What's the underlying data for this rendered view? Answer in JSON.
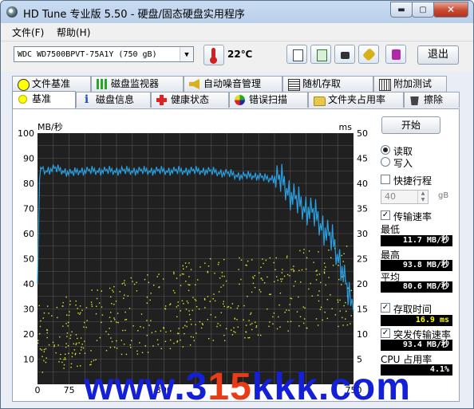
{
  "window": {
    "title": "HD Tune 专业版 5.50 - 硬盘/固态硬盘实用程序",
    "min": "▬",
    "max": "▢",
    "close": "✕"
  },
  "menu": {
    "file": "文件(F)",
    "help": "帮助(H)"
  },
  "toolbar": {
    "drive": "WDC    WD7500BPVT-75A1Y  (750 gB)",
    "temperature": "22℃",
    "exit": "退出"
  },
  "tabs_top": [
    {
      "label": "文件基准",
      "icon": "file-benchmark-icon"
    },
    {
      "label": "磁盘监视器",
      "icon": "disk-monitor-icon"
    },
    {
      "label": "自动噪音管理",
      "icon": "speaker-icon"
    },
    {
      "label": "随机存取",
      "icon": "random-access-icon"
    },
    {
      "label": "附加测试",
      "icon": "extra-tests-icon"
    }
  ],
  "tabs_bottom": [
    {
      "label": "基准",
      "icon": "benchmark-icon"
    },
    {
      "label": "磁盘信息",
      "icon": "info-icon"
    },
    {
      "label": "健康状态",
      "icon": "health-icon"
    },
    {
      "label": "错误扫描",
      "icon": "error-scan-icon"
    },
    {
      "label": "文件夹占用率",
      "icon": "folder-icon"
    },
    {
      "label": "擦除",
      "icon": "trash-icon"
    }
  ],
  "controls": {
    "start": "开始",
    "read": "读取",
    "write": "写入",
    "short_stroke": "快捷行程",
    "short_stroke_value": "40",
    "short_stroke_unit": "gB",
    "transfer_rate": "传输速率",
    "min_label": "最低",
    "min_value": "11.7 MB/秒",
    "max_label": "最高",
    "max_value": "93.8 MB/秒",
    "avg_label": "平均",
    "avg_value": "80.6 MB/秒",
    "access_time": "存取时间",
    "access_value": "16.9 ms",
    "burst_rate": "突发传输速率",
    "burst_value": "93.4 MB/秒",
    "cpu_label": "CPU 占用率",
    "cpu_value": "4.1%"
  },
  "colors": {
    "transfer_line": "#2a9fe0",
    "access_dots": "#e8e82a",
    "plot_bg": "#202020",
    "watermark_blue": "#1420d8",
    "watermark_red": "#e83b18"
  },
  "watermark": {
    "a": "www.3",
    "b": "15",
    "c": "kkk.com"
  },
  "chart_data": {
    "type": "line",
    "y_left_label": "MB/秒",
    "y_right_label": "ms",
    "ylim_left": [
      0,
      100
    ],
    "ylim_right": [
      0,
      50
    ],
    "y_left_ticks": [
      "10",
      "20",
      "30",
      "40",
      "50",
      "60",
      "70",
      "80",
      "90",
      "100"
    ],
    "y_right_ticks": [
      "5",
      "10",
      "15",
      "20",
      "25",
      "30",
      "35",
      "40",
      "45",
      "50"
    ],
    "xlim": [
      0,
      750
    ],
    "x_ticks_visible": [
      "0",
      "75",
      "300",
      "750"
    ],
    "grid": true,
    "series": [
      {
        "name": "传输速率",
        "axis": "left",
        "x": [
          0,
          5,
          10,
          20,
          40,
          60,
          80,
          100,
          150,
          200,
          250,
          300,
          350,
          400,
          450,
          480,
          500,
          520,
          540,
          560,
          580,
          600,
          620,
          640,
          660,
          680,
          700,
          720,
          740,
          750
        ],
        "values": [
          40,
          83,
          86,
          85,
          86,
          85,
          84,
          85,
          85,
          85,
          85,
          85,
          85,
          85,
          84,
          83,
          83,
          83,
          82,
          82,
          81,
          76,
          72,
          70,
          67,
          62,
          57,
          48,
          34,
          29
        ]
      },
      {
        "name": "存取时间",
        "axis": "right",
        "type": "scatter",
        "x_range": [
          0,
          750
        ],
        "values_range_min": [
          2,
          8,
          12
        ],
        "values_range_max": [
          16,
          25,
          28
        ]
      }
    ]
  }
}
